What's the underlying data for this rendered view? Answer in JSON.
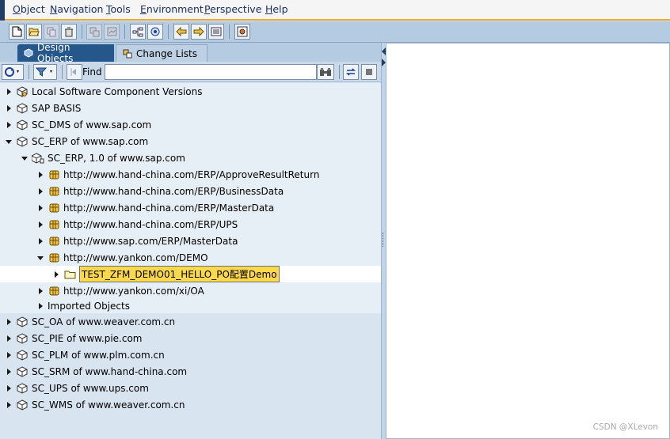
{
  "menu": [
    {
      "mnemonic": "O",
      "rest": "bject"
    },
    {
      "mnemonic": "N",
      "rest": "avigation"
    },
    {
      "mnemonic": "T",
      "rest": "ools"
    },
    {
      "mnemonic": "E",
      "rest": "nvironment"
    },
    {
      "mnemonic": "P",
      "rest": "erspective"
    },
    {
      "mnemonic": "H",
      "rest": "elp"
    }
  ],
  "toolbar_icons": [
    "new-document-icon",
    "open-folder-icon",
    "copy-icon",
    "delete-icon",
    "compare-icon",
    "history-icon",
    "tree-icon",
    "where-used-icon",
    "back-arrow-icon",
    "forward-arrow-icon",
    "list-icon",
    "settings-icon"
  ],
  "tabs": {
    "design_objects": "Design Objects",
    "change_lists": "Change Lists"
  },
  "search": {
    "find_label": "Find",
    "value": ""
  },
  "tree": {
    "items": [
      {
        "label": "Local Software Component Versions",
        "icon": "cube-stack-icon",
        "expand": "collapsed"
      },
      {
        "label": "SAP BASIS",
        "icon": "cube-icon",
        "expand": "collapsed"
      },
      {
        "label": "SC_DMS of www.sap.com",
        "icon": "cube-icon",
        "expand": "collapsed"
      },
      {
        "label": "SC_ERP of www.sap.com",
        "icon": "cube-icon",
        "expand": "expanded"
      },
      {
        "label": "SC_ERP, 1.0 of www.sap.com",
        "icon": "cube-version-icon",
        "expand": "expanded"
      },
      {
        "label": "http://www.hand-china.com/ERP/ApproveResultReturn",
        "icon": "namespace-icon",
        "expand": "collapsed"
      },
      {
        "label": "http://www.hand-china.com/ERP/BusinessData",
        "icon": "namespace-icon",
        "expand": "collapsed"
      },
      {
        "label": "http://www.hand-china.com/ERP/MasterData",
        "icon": "namespace-icon",
        "expand": "collapsed"
      },
      {
        "label": "http://www.hand-china.com/ERP/UPS",
        "icon": "namespace-icon",
        "expand": "collapsed"
      },
      {
        "label": "http://www.sap.com/ERP/MasterData",
        "icon": "namespace-icon",
        "expand": "collapsed"
      },
      {
        "label": "http://www.yankon.com/DEMO",
        "icon": "namespace-icon",
        "expand": "expanded"
      },
      {
        "label": "TEST_ZFM_DEMO01_HELLO_PO配置Demo",
        "icon": "folder-icon",
        "expand": "collapsed"
      },
      {
        "label": "http://www.yankon.com/xi/OA",
        "icon": "namespace-icon",
        "expand": "collapsed"
      },
      {
        "label": "Imported Objects",
        "icon": "",
        "expand": "collapsed"
      },
      {
        "label": "SC_OA of www.weaver.com.cn",
        "icon": "cube-icon",
        "expand": "collapsed"
      },
      {
        "label": "SC_PIE of www.pie.com",
        "icon": "cube-icon",
        "expand": "collapsed"
      },
      {
        "label": "SC_PLM of www.plm.com.cn",
        "icon": "cube-icon",
        "expand": "collapsed"
      },
      {
        "label": "SC_SRM of www.hand-china.com",
        "icon": "cube-icon",
        "expand": "collapsed"
      },
      {
        "label": "SC_UPS of www.ups.com",
        "icon": "cube-icon",
        "expand": "collapsed"
      },
      {
        "label": "SC_WMS of www.weaver.com.cn",
        "icon": "cube-icon",
        "expand": "collapsed"
      }
    ]
  },
  "watermark": "CSDN @XLevon",
  "colors": {
    "accent_line": "#f0a830",
    "active_tab": "#25578a",
    "highlight": "#fdd84a",
    "toolbar": "#b5cbe2"
  }
}
